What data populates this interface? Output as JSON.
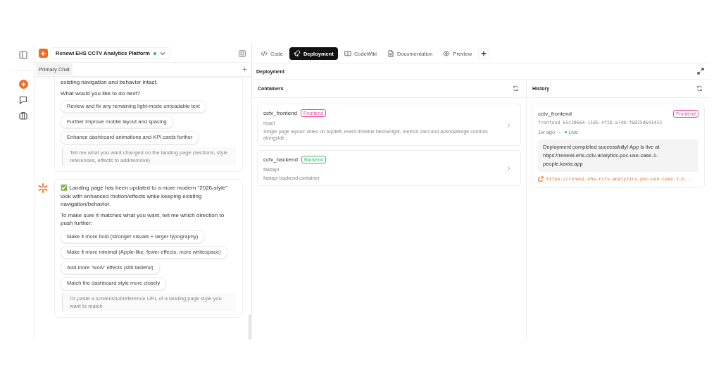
{
  "project": {
    "title": "Renewi EHS CCTV Analytics Platform",
    "online": true
  },
  "chat_tabs": [
    {
      "label": "Primary Chat",
      "selected": true
    }
  ],
  "messages": [
    {
      "paragraphs": [
        "existing navigation and behavior intact.",
        "What would you like to do next?"
      ],
      "suggestions": [
        "Review and fix any remaining light-mode unreadable text",
        "Further improve mobile layout and spacing",
        "Enhance dashboard animations and KPI cards further"
      ],
      "prompt": "Tell me what you want changed on the landing page (sections, style references, effects to add/remove)",
      "avatar": false
    },
    {
      "paragraphs": [
        "✅ Landing page has been updated to a more modern “2026-style” look with enhanced motion/effects while keeping existing navigation/behavior.",
        "To make sure it matches what you want, tell me which direction to push further:"
      ],
      "suggestions": [
        "Make it more bold (stronger visuals + larger typography)",
        "Make it more minimal (Apple-like, fewer effects, more whitespace)",
        "Add more “wow” effects (still tasteful)",
        "Match the dashboard style more closely"
      ],
      "prompt": "Or paste a screenshot/reference URL of a landing page style you want to match",
      "avatar": true
    }
  ],
  "tabs": [
    {
      "label": "Code",
      "kind": "code",
      "selected": false
    },
    {
      "label": "Deployment",
      "kind": "rocket",
      "selected": true
    },
    {
      "label": "CodeWiki",
      "kind": "book",
      "selected": false
    },
    {
      "label": "Documentation",
      "kind": "doc",
      "selected": false
    },
    {
      "label": "Preview",
      "kind": "eye",
      "selected": false
    }
  ],
  "page_title": "Deployment",
  "containers": {
    "title": "Containers",
    "items": [
      {
        "name": "cctv_frontend",
        "tag": "Frontend",
        "color": "#e8489a",
        "framework": "react",
        "description": "Single page layout: video on top/left, event timeline below/right, metrics card and acknowledge controls alongside..."
      },
      {
        "name": "cctv_backend",
        "tag": "Backend",
        "color": "#3cb86a",
        "framework": "fastapi",
        "description": "fastapi backend container"
      }
    ]
  },
  "history": {
    "title": "History",
    "items": [
      {
        "name": "cctv_frontend",
        "tag": "Frontend",
        "color": "#e8489a",
        "id": "frontend_65c30664-1105-4f1b-a74b-f6025d641433",
        "time": "1w ago",
        "status": "Live",
        "message": "Deployment completed successfully! App is live at https://renewi-ehs-cctv-analytics-poc-use-case-1-people.kavia.app",
        "link": "https://renewi-ehs-cctv-analytics-poc-use-case-1-p..."
      }
    ]
  }
}
